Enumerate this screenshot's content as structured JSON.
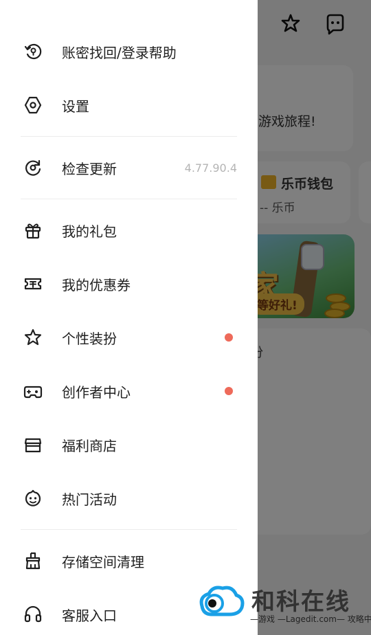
{
  "background": {
    "card_text_trip": "游戏旅程!",
    "wallet_title": "乐币钱包",
    "wallet_value": "-- 乐币",
    "banner_pill": "等好礼!",
    "banner_glyph": "家",
    "faded_char": "份",
    "top_icons": [
      "dressup-icon",
      "message-icon"
    ]
  },
  "drawer": {
    "items": [
      {
        "name": "account-recovery",
        "icon": "account-recovery-icon",
        "label": "账密找回/登录帮助"
      },
      {
        "name": "settings",
        "icon": "settings-icon",
        "label": "设置"
      },
      {
        "name": "check-update",
        "icon": "refresh-icon",
        "label": "检查更新",
        "version": "4.77.90.4"
      },
      {
        "name": "my-gift",
        "icon": "gift-icon",
        "label": "我的礼包"
      },
      {
        "name": "my-coupon",
        "icon": "coupon-icon",
        "label": "我的优惠券"
      },
      {
        "name": "personal-dressup",
        "icon": "star-icon",
        "label": "个性装扮",
        "badge": true
      },
      {
        "name": "creator-center",
        "icon": "gamepad-icon",
        "label": "创作者中心",
        "badge": true
      },
      {
        "name": "welfare-store",
        "icon": "store-icon",
        "label": "福利商店"
      },
      {
        "name": "hot-events",
        "icon": "smile-icon",
        "label": "热门活动"
      },
      {
        "name": "storage-clean",
        "icon": "broom-icon",
        "label": "存储空间清理"
      },
      {
        "name": "customer-service",
        "icon": "headset-icon",
        "label": "客服入口"
      }
    ]
  },
  "watermark": {
    "text": "和科在线",
    "sub": "—游戏 —Lagedit.com— 攻略中—"
  },
  "colors": {
    "badge": "#ee6a5a",
    "label": "#1f1f1f",
    "version": "#b4b4b4",
    "divider": "#ececec",
    "watermark_blue": "#1aa0e6"
  }
}
